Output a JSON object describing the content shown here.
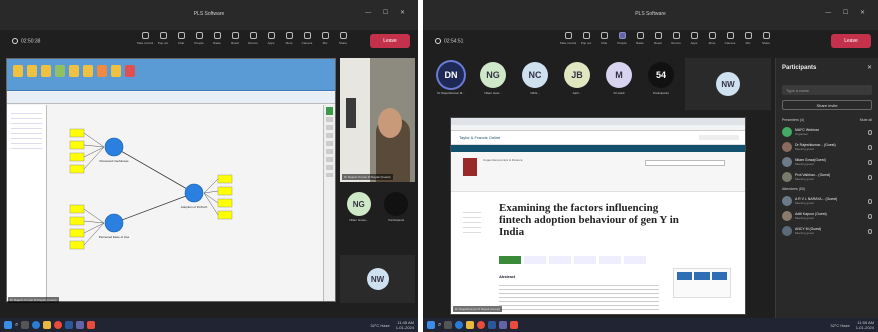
{
  "left": {
    "title": "PLS Software",
    "window_controls": "— ☐ ✕",
    "timer": "02:50:38",
    "toolbar": [
      {
        "label": "Take control",
        "icon": "hand-icon"
      },
      {
        "label": "Pop out",
        "icon": "popout-icon"
      },
      {
        "label": "Chat",
        "icon": "chat-icon"
      },
      {
        "label": "People",
        "icon": "people-icon"
      },
      {
        "label": "Raise",
        "icon": "hand-raise-icon"
      },
      {
        "label": "React",
        "icon": "smile-icon"
      },
      {
        "label": "Rooms",
        "icon": "rooms-icon"
      },
      {
        "label": "Apps",
        "icon": "apps-icon"
      },
      {
        "label": "More",
        "icon": "more-icon"
      },
      {
        "label": "Camera",
        "icon": "camera-icon"
      },
      {
        "label": "Mic",
        "icon": "mic-icon"
      },
      {
        "label": "Share",
        "icon": "share-icon"
      }
    ],
    "leave": "Leave",
    "presenter_caption": "Dr Rajesh Kumar M Nayak (Guest)",
    "video_caption": "Dr Rajesh Kumar M Nayak (Guest)",
    "tiles": [
      {
        "initials": "NG",
        "label": "Nilam Gowa..."
      },
      {
        "initials": "",
        "label": "Participants"
      }
    ],
    "nw_initials": "NW",
    "model": {
      "construct1": "Perceived Usefulness",
      "construct2": "Perceived Ease of Use",
      "construct3": "Adoption of FinTech"
    },
    "clock": {
      "time": "11:45 AM",
      "date": "1-01-2024"
    },
    "weather": "32°C Haze"
  },
  "right": {
    "title": "PLS Software",
    "window_controls": "— ☐ ✕",
    "timer": "02:54:51",
    "toolbar": [
      {
        "label": "Take control",
        "icon": "hand-icon"
      },
      {
        "label": "Pop out",
        "icon": "popout-icon"
      },
      {
        "label": "Chat",
        "icon": "chat-icon"
      },
      {
        "label": "People",
        "icon": "people-icon",
        "active": true
      },
      {
        "label": "Raise",
        "icon": "hand-raise-icon"
      },
      {
        "label": "React",
        "icon": "smile-icon"
      },
      {
        "label": "Rooms",
        "icon": "rooms-icon"
      },
      {
        "label": "Apps",
        "icon": "apps-icon"
      },
      {
        "label": "More",
        "icon": "more-icon"
      },
      {
        "label": "Camera",
        "icon": "camera-icon"
      },
      {
        "label": "Mic",
        "icon": "mic-icon"
      },
      {
        "label": "Share",
        "icon": "share-icon"
      }
    ],
    "leave": "Leave",
    "avatars": [
      {
        "initials": "DN",
        "label": "Dr Rajeshkumar M...",
        "bg": "#1e2a55",
        "fg": "#fff",
        "ring": "#6b7ad8"
      },
      {
        "initials": "NG",
        "label": "Nilam Gow...",
        "bg": "#cfe9c8",
        "fg": "#334",
        "ring": ""
      },
      {
        "initials": "NC",
        "label": "Nikhi...",
        "bg": "#cfe0ef",
        "fg": "#334",
        "ring": ""
      },
      {
        "initials": "JB",
        "label": "Aarh...",
        "bg": "#dfe6c0",
        "fg": "#334",
        "ring": ""
      },
      {
        "initials": "M",
        "label": "Dn Hadi",
        "bg": "#d8d4f0",
        "fg": "#334",
        "ring": ""
      },
      {
        "initials": "54",
        "label": "Participants",
        "bg": "#111",
        "fg": "#fff",
        "ring": ""
      }
    ],
    "nw_initials": "NW",
    "paper": {
      "publisher": "Taylor & Francis Online",
      "journal": "Cogent Economics & Finance",
      "title": "Examining the factors influencing fintech adoption behaviour of gen Y in India",
      "abstract_heading": "Abstract",
      "cta": "Download PDF"
    },
    "share_caption": "Dr Rajeshkumar M Nayak (Guest)",
    "participants": {
      "heading": "Participants",
      "search_placeholder": "Type a name",
      "share_invite": "Share invite",
      "presenters_heading": "Presenters (4)",
      "mute_all": "Mute all",
      "presenters": [
        {
          "initials": "",
          "name": "MAFC Webinar",
          "role": "Organiser",
          "bg": "#4a6"
        },
        {
          "initials": "",
          "name": "Dr Rajeshkumar... (Guest)",
          "role": "Meeting guest",
          "bg": "#8a6a5a"
        },
        {
          "initials": "",
          "name": "Nilam Gowa(Guest)",
          "role": "Meeting guest",
          "bg": "#6b7b8a"
        },
        {
          "initials": "",
          "name": "Prof.Vaibhav... (Guest)",
          "role": "Meeting guest",
          "bg": "#7a7a6a"
        }
      ],
      "attendees_heading": "Attendees (50)",
      "attendees": [
        {
          "initials": "",
          "name": "A R V L NARAYA... (Guest)",
          "role": "Meeting guest",
          "bg": "#6a7a8a"
        },
        {
          "initials": "",
          "name": "Aditi Kapoor (Guest)",
          "role": "Meeting guest",
          "bg": "#8a7a6a"
        },
        {
          "initials": "",
          "name": "ANCY M (Guest)",
          "role": "Meeting guest",
          "bg": "#5a6a7a"
        }
      ]
    },
    "clock": {
      "time": "11:55 AM",
      "date": "1-01-2024"
    },
    "weather": "32°C Haze"
  }
}
